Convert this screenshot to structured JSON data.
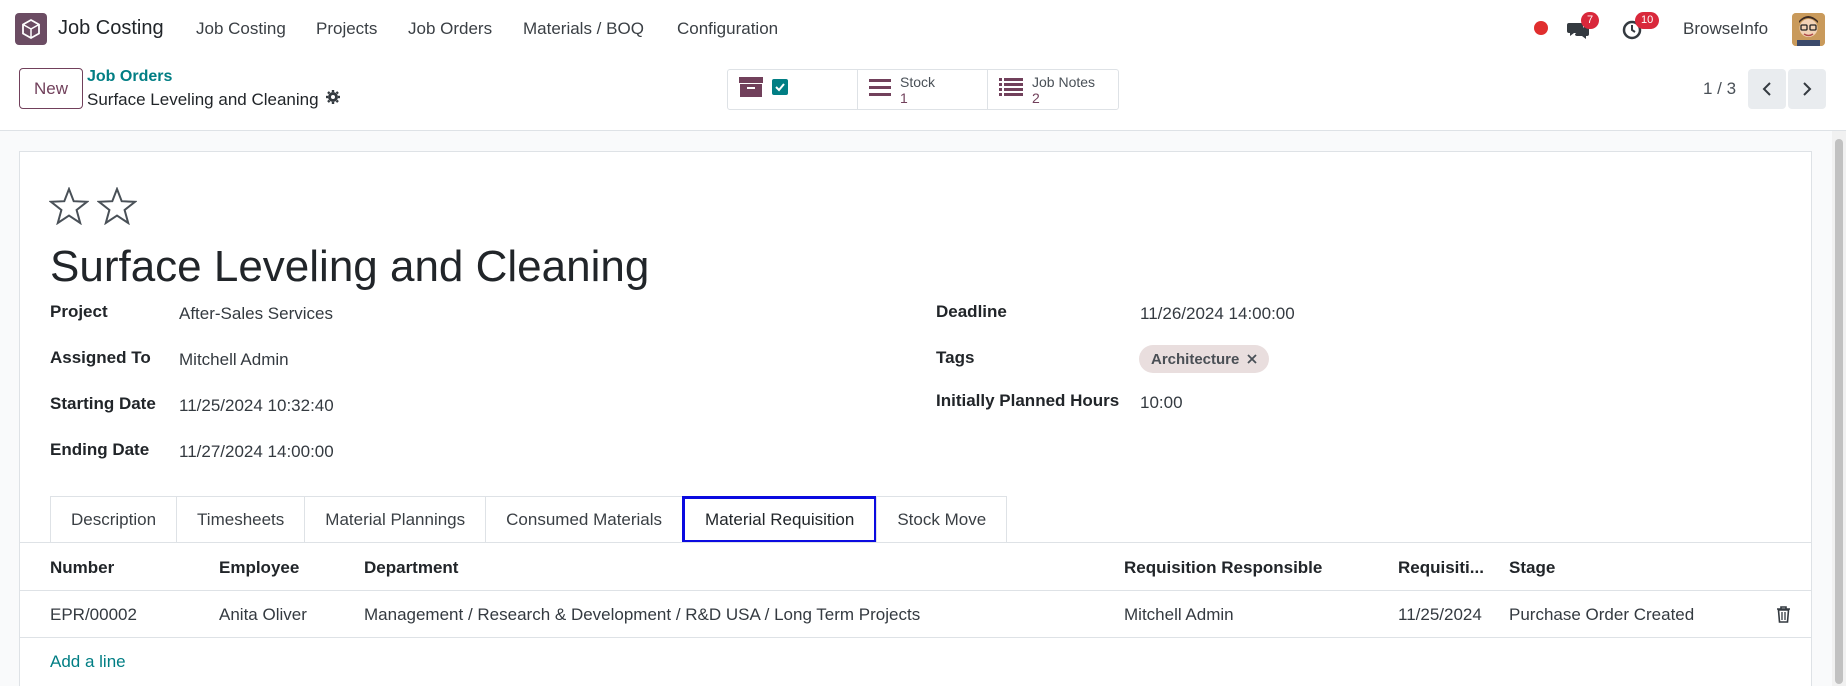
{
  "topnav": {
    "app_name": "Job Costing",
    "menus": [
      "Job Costing",
      "Projects",
      "Job Orders",
      "Materials / BOQ",
      "Configuration"
    ],
    "messages_count": "7",
    "activities_count": "10",
    "user_name": "BrowseInfo"
  },
  "control": {
    "new_label": "New",
    "breadcrumb_parent": "Job Orders",
    "breadcrumb_current": "Surface Leveling and Cleaning",
    "smart_buttons": [
      {
        "label": "Stock",
        "value": "1"
      },
      {
        "label": "Job Notes",
        "value": "2"
      }
    ],
    "pager": "1 / 3"
  },
  "record": {
    "title": "Surface Leveling and Cleaning",
    "fields_left": [
      {
        "label": "Project",
        "value": "After-Sales Services"
      },
      {
        "label": "Assigned To",
        "value": "Mitchell Admin"
      },
      {
        "label": "Starting Date",
        "value": "11/25/2024 10:32:40"
      },
      {
        "label": "Ending Date",
        "value": "11/27/2024 14:00:00"
      }
    ],
    "fields_right": [
      {
        "label": "Deadline",
        "value": "11/26/2024 14:00:00"
      },
      {
        "label": "Tags",
        "value": ""
      },
      {
        "label": "Initially Planned Hours",
        "value": "10:00"
      }
    ],
    "tag": "Architecture"
  },
  "tabs": [
    "Description",
    "Timesheets",
    "Material Plannings",
    "Consumed Materials",
    "Material Requisition",
    "Stock Move"
  ],
  "active_tab": "Material Requisition",
  "table": {
    "columns": [
      "Number",
      "Employee",
      "Department",
      "Requisition Responsible",
      "Requisiti...",
      "Stage"
    ],
    "rows": [
      [
        "EPR/00002",
        "Anita Oliver",
        "Management / Research & Development / R&D USA / Long Term Projects",
        "Mitchell Admin",
        "11/25/2024",
        "Purchase Order Created"
      ]
    ],
    "add_line": "Add a line"
  },
  "colors": {
    "brand": "#71405b",
    "link": "#017e84",
    "highlight": "#0b0be0"
  }
}
